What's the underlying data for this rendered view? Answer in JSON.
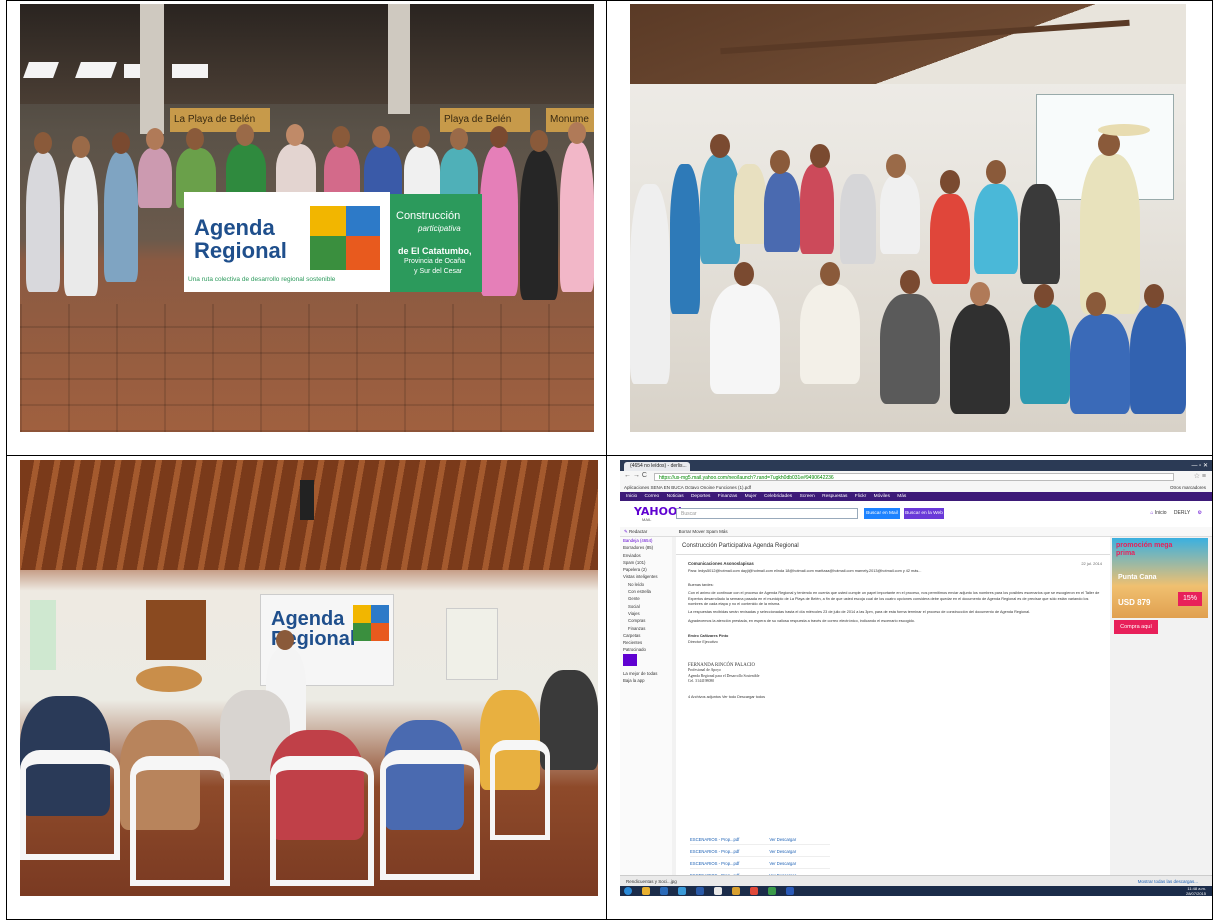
{
  "colors": {
    "yahoo_purple": "#3d1a78",
    "yahoo_logo": "#5f01d1",
    "yahoo_button": "#1d83ff",
    "banner_green": "#2c9a5c",
    "banner_blue": "#1f4f8c"
  },
  "photo1": {
    "banner_left_line1": "Agenda",
    "banner_left_line2": "Regional",
    "banner_left_tagline": "Una ruta colectiva de desarrollo regional sostenible",
    "banner_right_line1": "Construcción",
    "banner_right_line2": "participativa",
    "banner_right_line3": "de El Catatumbo,",
    "banner_right_line4": "Provincia de Ocaña",
    "banner_right_line5": "y Sur del Cesar",
    "wall_sign_1": "La Playa de Belén",
    "wall_sign_2": "Playa de Belén",
    "wall_sign_3": "Monume"
  },
  "photo3": {
    "projection_line1": "Agenda",
    "projection_line2": "Regional"
  },
  "browser": {
    "tab_title": "(4654 no leídos) - derlis...",
    "url": "https://us-mg5.mail.yahoo.com/neo/launch?.rand=7ugkh0db031e#9490642236",
    "bookmarks": "Aplicaciones  SENA EN BUCA  Octavo Onoine  Funciones (1).pdf",
    "other_bookmarks": "Otros marcadores"
  },
  "yahoo": {
    "nav": [
      "Inicio",
      "Correo",
      "Noticias",
      "Deportes",
      "Finanzas",
      "Mujer",
      "Celebridades",
      "Screen",
      "Respuestas",
      "Flickr",
      "Móviles",
      "Más"
    ],
    "logo": "YAHOO!",
    "logo_sub": "MAIL",
    "search_placeholder": "Buscar",
    "btn_mail": "Buscar en Mail",
    "btn_web": "Buscar en la Web",
    "user_home": "Inicio",
    "user_name": "DERLY",
    "compose": "Redactar",
    "toolbar": "Borrar   Mover   Spam   Más",
    "sidebar": [
      "Bandeja (4654)",
      "Borradores (85)",
      "Enviados",
      "Spam (101)",
      "Papelera (2)",
      "Vistas inteligentes",
      "No leído",
      "Con estrella",
      "Gente",
      "Social",
      "Viajes",
      "Compras",
      "Finanzas",
      "Carpetas",
      "Recientes",
      "Patrocinado",
      "La mejor de todas",
      "Baja la app"
    ],
    "message_title": "Construcción Participativa Agenda Regional",
    "sender": "Comunicaciones Asonoslapisas",
    "date": "22 jul. 2014",
    "to": "Para: ledys5012@hotmail.com dayji@hotmail.com elinda 18@hotmail.com maritzaa@hotmail.com marnely.2013@hotmail.com y 42 más...",
    "greeting": "Buenas tardes:",
    "para1": "Con el animo de continuar con el proceso de Agenda Regional y teniendo en cuenta que usted cumple un papel importante en el proceso, nos permitimos enviar adjunto los nombres para los posibles escenarios que se escogieron en el Taller de Expertos desarrollado la semana pasada en el municipio de La Playa de Belén, a fin de que usted escoja cual de los cuatro opciones considera debe quedar en el documento de Agenda Regional es de precisar que sólo están variando los nombres de cada etapa y no el contenido de la misma.",
    "para2": "La respuestas recibidas serán revisadas y seleccionadas hasta el día miércoles 23 de julio de 2014 a las 3pm, para de esta forma terminar el proceso de construcción del documento de Agenda Regional.",
    "para3": "Agradecemos la atención prestada, en espera de su valiosa respuesta a través de correo electrónico, indicando el escenario escogido.",
    "sig1_name": "Emiro Cañizares Pinto",
    "sig1_title": "Director Ejecutivo",
    "sig2_name": "FERNANDA RINCÓN PALACIO",
    "sig2_l1": "Profesional de Apoyo",
    "sig2_l2": "Agenda Regional para el Desarrollo Sostenible",
    "sig2_l3": "Cel. 3144198080",
    "attach_header": "4 Archivos adjuntos   Ver todo   Descargar todos",
    "attachments": [
      "ESCENARIOS - Prop...pdf",
      "ESCENARIOS - Prop...pdf",
      "ESCENARIOS - Prop...pdf",
      "ESCENARIOS - Prop...pdf"
    ],
    "attach_actions": "Ver  Descargar",
    "ad_1": "promoción mega prima",
    "ad_2": "Punta Cana",
    "ad_3": "USD 879",
    "ad_4": "15%",
    "ad_5": "Compra aquí",
    "download_file": "Rendicuentas y Soci...jpg",
    "download_all": "Mostrar todas las descargas...",
    "clock": "11:48 a.m.",
    "clock_date": "28/07/2015"
  }
}
